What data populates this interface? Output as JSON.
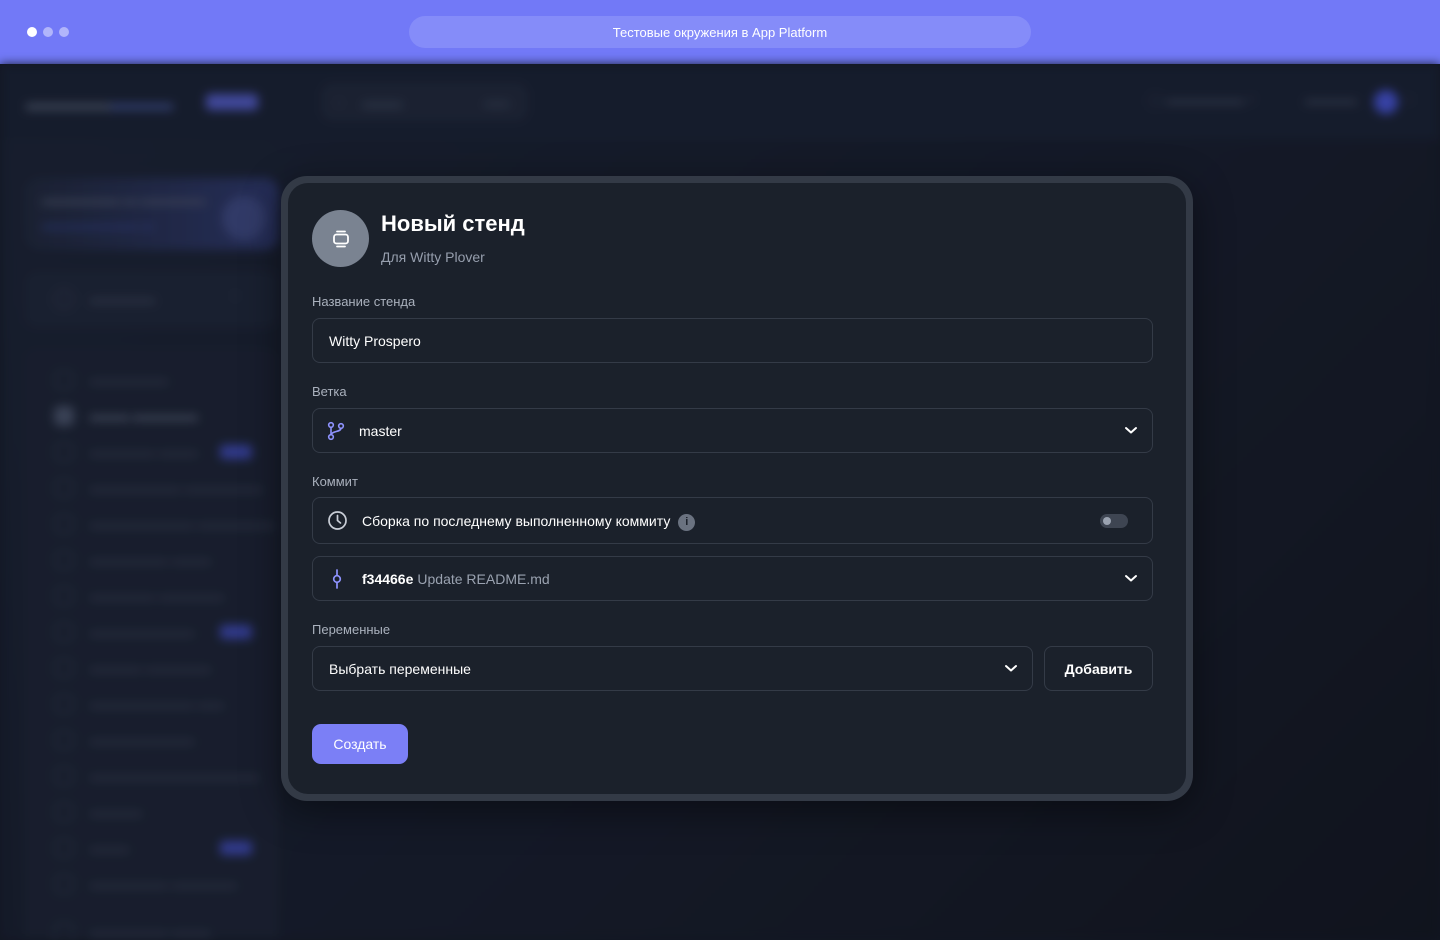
{
  "browser": {
    "url_title": "Тестовые окружения в App Platform"
  },
  "colors": {
    "accent": "#7b7ff6",
    "chrome": "#7279f7",
    "modal_bg": "#1b212b",
    "page_bg": "#141a26"
  },
  "modal": {
    "icon": "app-stand-icon",
    "title": "Новый стенд",
    "subtitle": "Для Witty Plover",
    "name_field": {
      "label": "Название стенда",
      "value": "Witty Prospero"
    },
    "branch_field": {
      "label": "Ветка",
      "icon": "git-branch-icon",
      "value": "master"
    },
    "commit_section": {
      "label": "Коммит",
      "latest_commit_toggle": {
        "icon": "clock-icon",
        "label": "Сборка по последнему выполненному коммиту",
        "info_icon": "i",
        "enabled": false
      },
      "commit_select": {
        "icon": "git-commit-icon",
        "hash": "f34466e",
        "message": "Update README.md"
      }
    },
    "variables_field": {
      "label": "Переменные",
      "placeholder": "Выбрать переменные",
      "add_label": "Добавить"
    },
    "create_label": "Создать"
  }
}
